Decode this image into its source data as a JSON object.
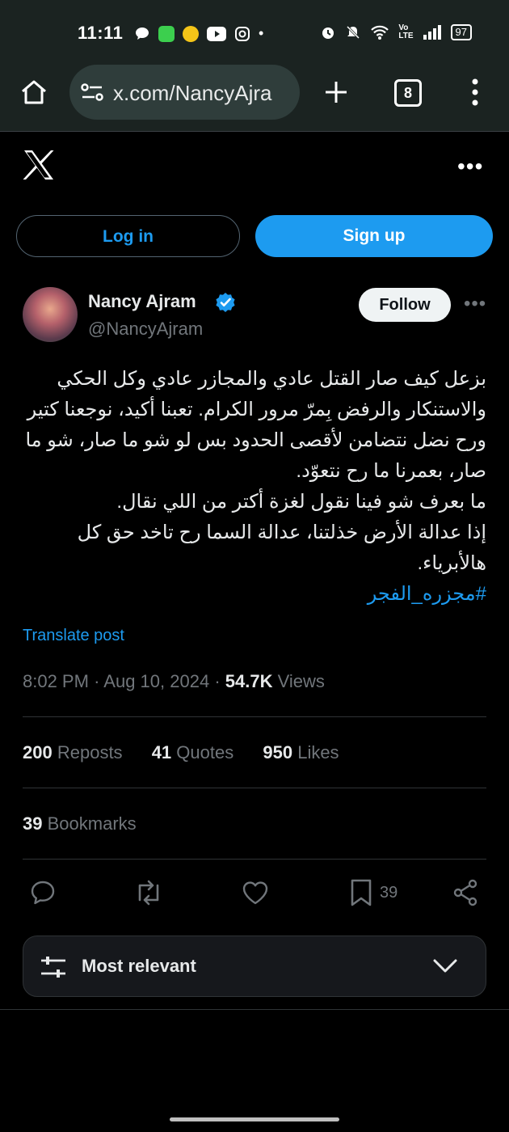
{
  "status_bar": {
    "time": "11:11",
    "battery": "97"
  },
  "browser": {
    "url": "x.com/NancyAjra",
    "tab_count": "8"
  },
  "auth": {
    "login_label": "Log in",
    "signup_label": "Sign up"
  },
  "profile": {
    "name": "Nancy Ajram",
    "handle": "@NancyAjram",
    "follow_label": "Follow"
  },
  "tweet": {
    "lines": [
      "بزعل كيف صار القتل عادي والمجازر عادي وكل الحكي",
      "والاستنكار والرفض بِمرّ مرور الكرام. تعبنا أكيد، نوجعنا كتير",
      "ورح نضل نتضامن لأقصى الحدود بس لو شو ما صار، شو ما",
      "صار،  بعمرنا ما رح نتعوّد.",
      "ما بعرف شو فينا نقول لغزة أكتر من اللي نقال.",
      "إذا عدالة الأرض خذلتنا، عدالة السما رح تاخد حق كل",
      "هالأبرياء."
    ],
    "hashtag": "#مجزره_الفجر",
    "translate_label": "Translate post",
    "time": "8:02 PM",
    "date": "Aug 10, 2024",
    "views_count": "54.7K",
    "views_label": "Views"
  },
  "stats": {
    "reposts_count": "200",
    "reposts_label": "Reposts",
    "quotes_count": "41",
    "quotes_label": "Quotes",
    "likes_count": "950",
    "likes_label": "Likes",
    "bookmarks_count": "39",
    "bookmarks_label": "Bookmarks"
  },
  "actions": {
    "bookmark_count": "39"
  },
  "sort": {
    "label": "Most relevant"
  },
  "colors": {
    "accent": "#1d9bf0",
    "background": "#000000",
    "browser_chrome": "#1b2321"
  }
}
